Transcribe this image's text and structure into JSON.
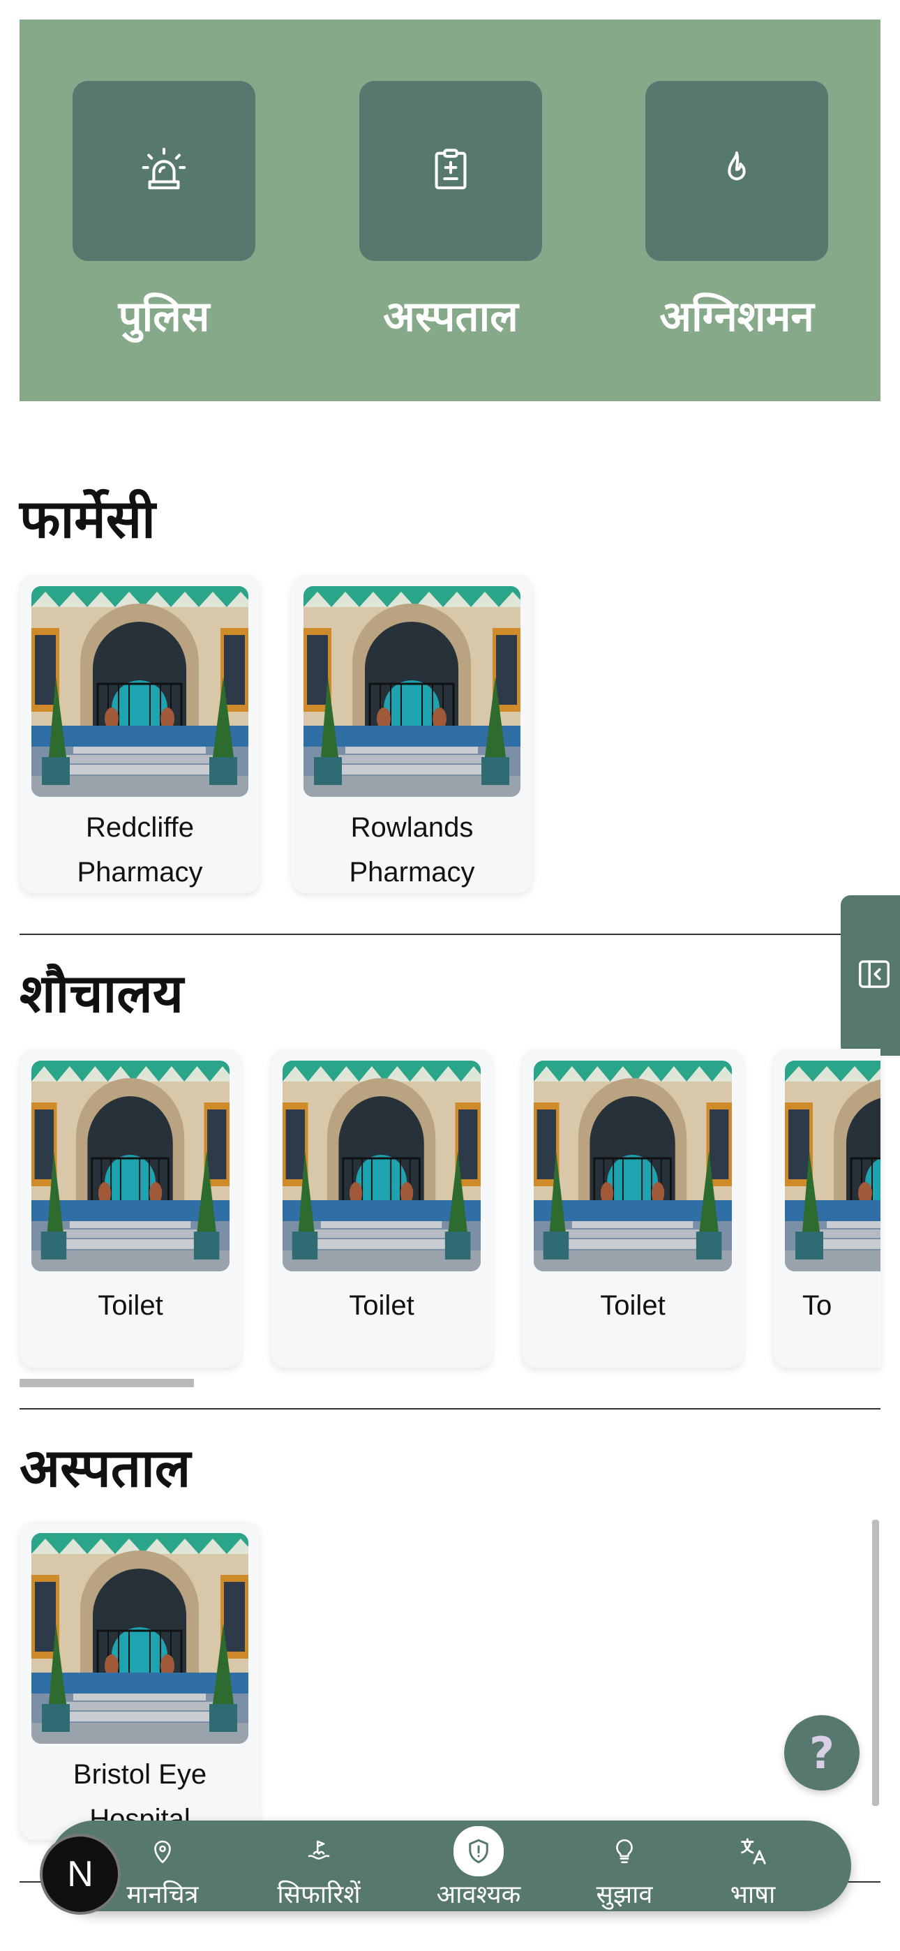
{
  "emergency": {
    "items": [
      {
        "label": "पुलिस",
        "icon": "siren-icon"
      },
      {
        "label": "अस्पताल",
        "icon": "medical-file-icon"
      },
      {
        "label": "अग्निशमन",
        "icon": "flame-icon"
      }
    ]
  },
  "sections": {
    "pharmacy": {
      "title": "फार्मेसी",
      "cards": [
        {
          "line1": "Redcliffe",
          "line2": "Pharmacy"
        },
        {
          "line1": "Rowlands",
          "line2": "Pharmacy"
        }
      ]
    },
    "toilets": {
      "title": "शौचालय",
      "cards": [
        {
          "label": "Toilet"
        },
        {
          "label": "Toilet"
        },
        {
          "label": "Toilet"
        },
        {
          "label": "To"
        }
      ]
    },
    "hospitals": {
      "title": "अस्पताल",
      "cards": [
        {
          "line1": "Bristol Eye",
          "line2": "Hospital"
        }
      ]
    }
  },
  "side_tab": {
    "icon": "collapse-panel-icon"
  },
  "help": {
    "label": "?",
    "icon": "question-icon"
  },
  "logo": {
    "letter": "N"
  },
  "bottom_nav": {
    "items": [
      {
        "label": "मानचित्र",
        "icon": "map-pin-icon"
      },
      {
        "label": "सिफारिशें",
        "icon": "recommend-icon"
      },
      {
        "label": "आवश्यक",
        "icon": "shield-icon",
        "active": true
      },
      {
        "label": "सुझाव",
        "icon": "lightbulb-icon"
      },
      {
        "label": "भाषा",
        "icon": "translate-icon"
      }
    ]
  },
  "colors": {
    "panel": "#86a98a",
    "accent": "#57786f"
  }
}
